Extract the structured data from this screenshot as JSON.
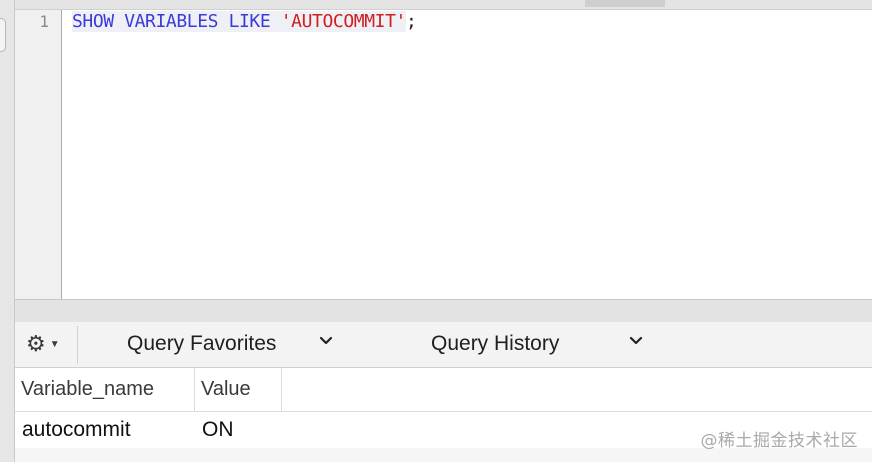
{
  "editor": {
    "line_number": "1",
    "tokens": {
      "kw1": "SHOW",
      "kw2": "VARIABLES",
      "kw3": "LIKE",
      "str": "'AUTOCOMMIT'",
      "semi": ";"
    }
  },
  "toolbar": {
    "gear_icon": "gear-icon",
    "query_favorites": "Query Favorites",
    "query_history": "Query History"
  },
  "results": {
    "columns": [
      "Variable_name",
      "Value"
    ],
    "rows": [
      [
        "autocommit",
        "ON"
      ]
    ]
  },
  "watermark": "@稀土掘金技术社区",
  "colors": {
    "keyword": "#3b3bd8",
    "string": "#d01f1f"
  }
}
